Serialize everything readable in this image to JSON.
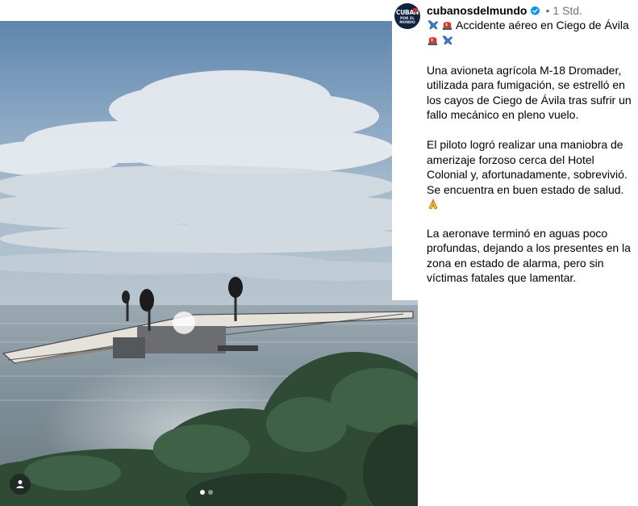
{
  "post": {
    "username": "cubanosdelmundo",
    "avatar_text_top": "CUBAN",
    "avatar_text_bottom": "POR EL MUNDO",
    "separator": "•",
    "time": "1 Std.",
    "title": "Accidente aéreo en Ciego de Ávila",
    "paragraphs": [
      "Una avioneta agrícola M-18 Dromader, utilizada para fumigación, se estrelló en los cayos de Ciego de Ávila tras sufrir un fallo mecánico en pleno vuelo.",
      "El piloto logró realizar una maniobra de amerizaje forzoso cerca del Hotel Colonial y, afortunadamente, sobrevivió. Se encuentra en buen estado de salud.",
      "La aeronave terminó en aguas poco profundas, dejando a los presentes en la zona en estado de alarma, pero sin víctimas fatales que lamentar."
    ]
  },
  "media": {
    "carousel_total": 2,
    "carousel_active": 1
  },
  "colors": {
    "verified": "#0095f6",
    "muted_text": "#737373",
    "siren": "#e0302b",
    "airplane": "#3a7bd5"
  }
}
